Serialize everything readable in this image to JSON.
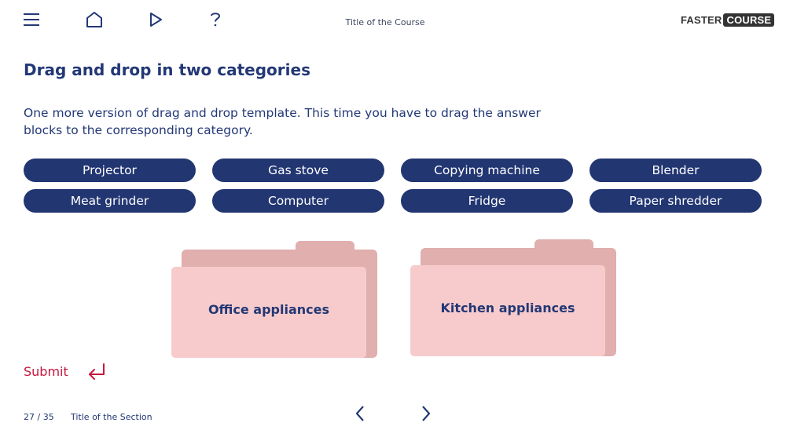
{
  "header": {
    "icons": [
      "menu-icon",
      "home-icon",
      "play-icon",
      "help-icon"
    ],
    "course_title": "Title of the Course",
    "logo": {
      "part1": "FASTER",
      "part2": "COURSE"
    }
  },
  "main": {
    "title": "Drag and drop in two categories",
    "instructions": "One more version of drag and drop template. This time you have to drag the answer blocks to the corresponding category.",
    "answer_blocks": [
      "Projector",
      "Gas stove",
      "Copying machine",
      "Blender",
      "Meat grinder",
      "Computer",
      "Fridge",
      "Paper shredder"
    ],
    "categories": [
      {
        "label": "Office appliances"
      },
      {
        "label": "Kitchen appliances"
      }
    ],
    "submit_label": "Submit"
  },
  "footer": {
    "page_indicator": "27 / 35",
    "section_title": "Title of the Section"
  },
  "colors": {
    "primary": "#223672",
    "accent": "#c8163e",
    "folder_front": "#f7cbcb",
    "folder_back": "#e0afae"
  }
}
